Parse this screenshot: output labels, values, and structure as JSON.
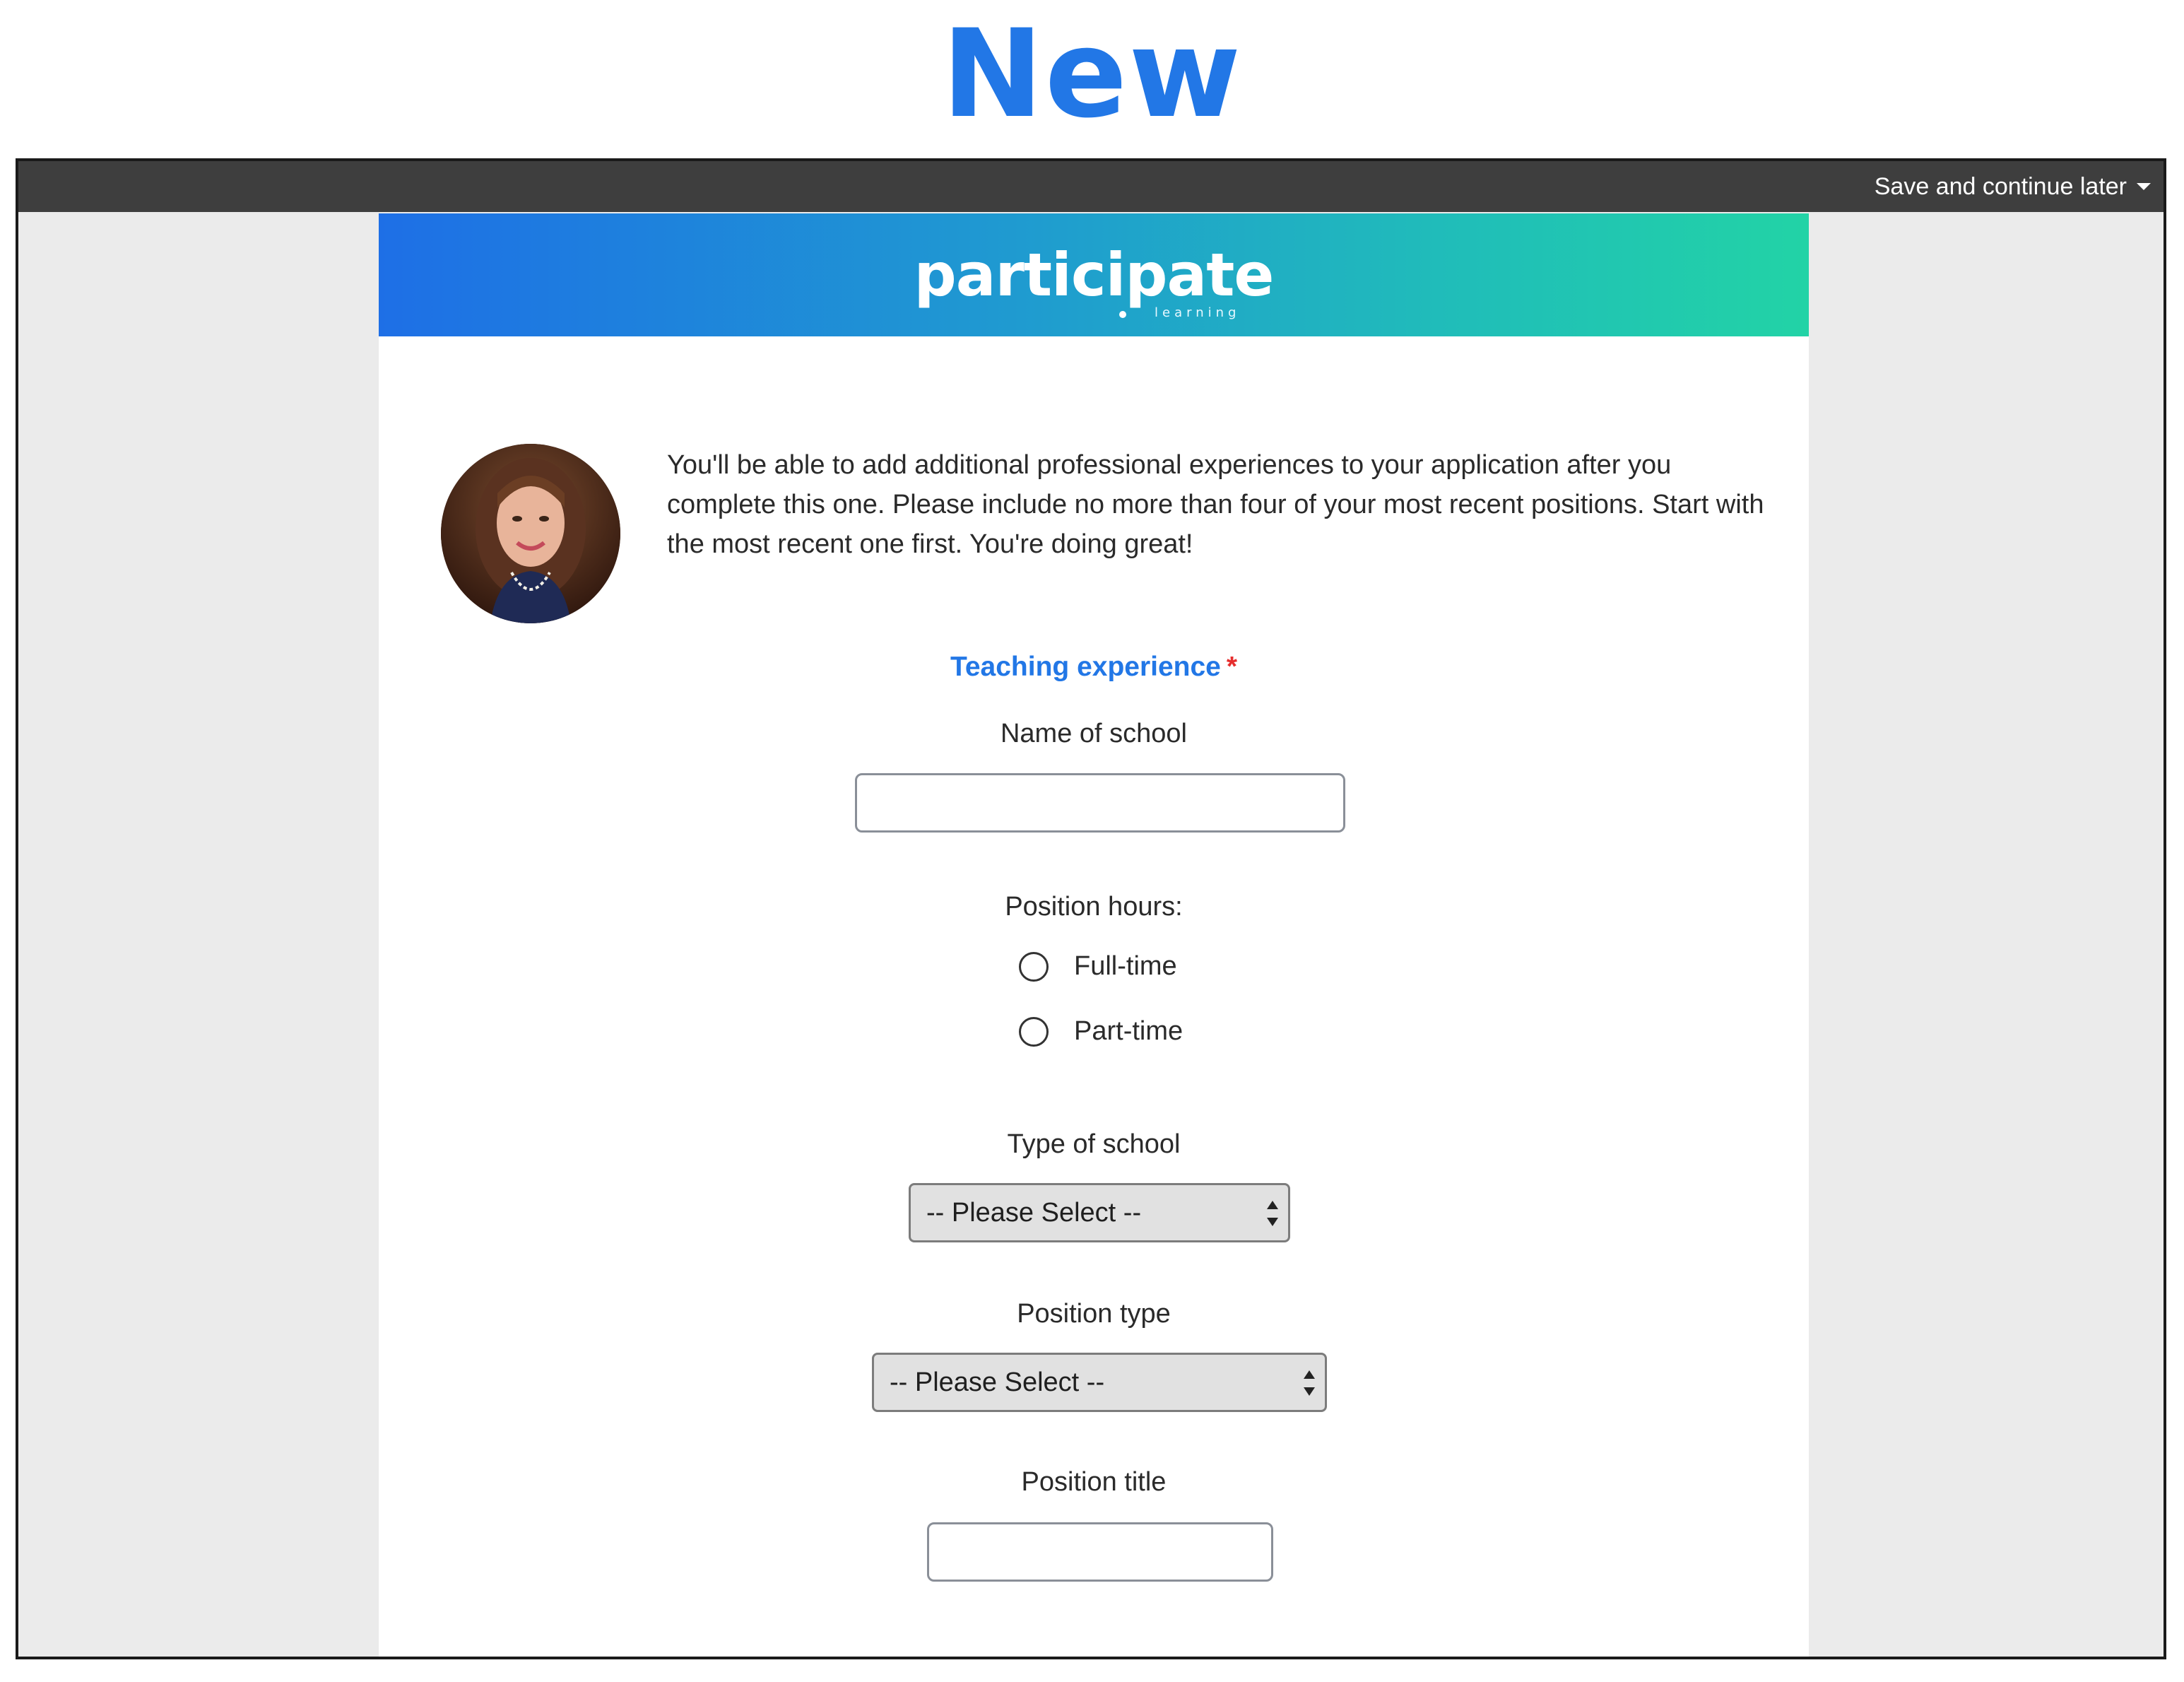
{
  "heading": "New",
  "topbar": {
    "save_later": "Save and continue later"
  },
  "banner": {
    "logo_word": "participate",
    "logo_sub": "learning",
    "gradient_start": "#1e6fe6",
    "gradient_end": "#22d3a6"
  },
  "intro": {
    "text": "You'll be able to add additional professional experiences to your application after you complete this one. Please include no more than four of your most recent positions. Start with the most recent one first. You're doing great!"
  },
  "form": {
    "section_title": "Teaching experience",
    "required_mark": "*",
    "school_name_label": "Name of school",
    "school_name_value": "",
    "position_hours_label": "Position hours:",
    "hours_options": [
      "Full-time",
      "Part-time"
    ],
    "school_type_label": "Type of school",
    "school_type_value": "-- Please Select --",
    "position_type_label": "Position type",
    "position_type_value": "-- Please Select --",
    "position_title_label": "Position title",
    "position_title_value": ""
  },
  "colors": {
    "accent": "#2277e6",
    "required": "#e62e2e",
    "topbar": "#3e3e3e"
  }
}
